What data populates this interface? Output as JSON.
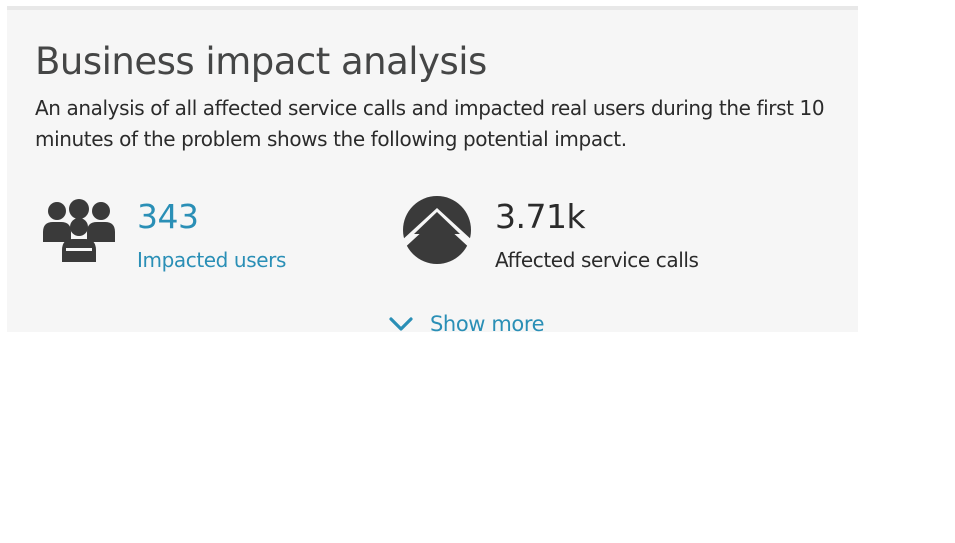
{
  "panel": {
    "title": "Business impact analysis",
    "description": "An analysis of all affected service calls and impacted real users during the first 10 minutes of the problem shows the following potential impact."
  },
  "metrics": [
    {
      "icon": "users-group-icon",
      "value": "343",
      "label": "Impacted users",
      "color": "#2a8fb6"
    },
    {
      "icon": "service-calls-icon",
      "value": "3.71k",
      "label": "Affected service calls",
      "color": "#2b2b2b"
    }
  ],
  "show_more": {
    "icon": "chevron-down-icon",
    "label": "Show more",
    "color": "#2a8fb6"
  },
  "colors": {
    "panel_background": "#f6f6f6",
    "title": "#454646",
    "body_text": "#2b2b2b",
    "accent": "#2a8fb6",
    "icon": "#3a3a3a"
  }
}
